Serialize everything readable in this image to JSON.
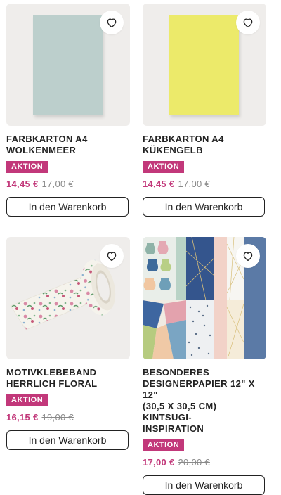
{
  "products": [
    {
      "title_line1": "FARBKARTON A4",
      "title_line2": "WOLKENMEER",
      "badge": "AKTION",
      "price_new": "14,45 €",
      "price_old": "17,00 €",
      "cta": "In den Warenkorb",
      "favorite_icon": "heart-icon",
      "swatch_color": "#bccfcc"
    },
    {
      "title_line1": "FARBKARTON A4",
      "title_line2": "KÜKENGELB",
      "badge": "AKTION",
      "price_new": "14,45 €",
      "price_old": "17,00 €",
      "cta": "In den Warenkorb",
      "favorite_icon": "heart-icon",
      "swatch_color": "#ecea6a"
    },
    {
      "title_line1": "MOTIVKLEBEBAND",
      "title_line2": "HERRLICH FLORAL",
      "badge": "AKTION",
      "price_new": "16,15 €",
      "price_old": "19,00 €",
      "cta": "In den Warenkorb",
      "favorite_icon": "heart-icon"
    },
    {
      "title_line1": "BESONDERES",
      "title_line2": "DESIGNERPAPIER 12\" X 12\"",
      "title_line3": "(30,5 X 30,5 CM) KINTSUGI-",
      "title_line4": "INSPIRATION",
      "badge": "AKTION",
      "price_new": "17,00 €",
      "price_old": "20,00 €",
      "cta": "In den Warenkorb",
      "favorite_icon": "heart-icon"
    }
  ],
  "colors": {
    "accent": "#c2387a",
    "old_price": "#8a8a8a",
    "image_bg": "#efedeb"
  }
}
